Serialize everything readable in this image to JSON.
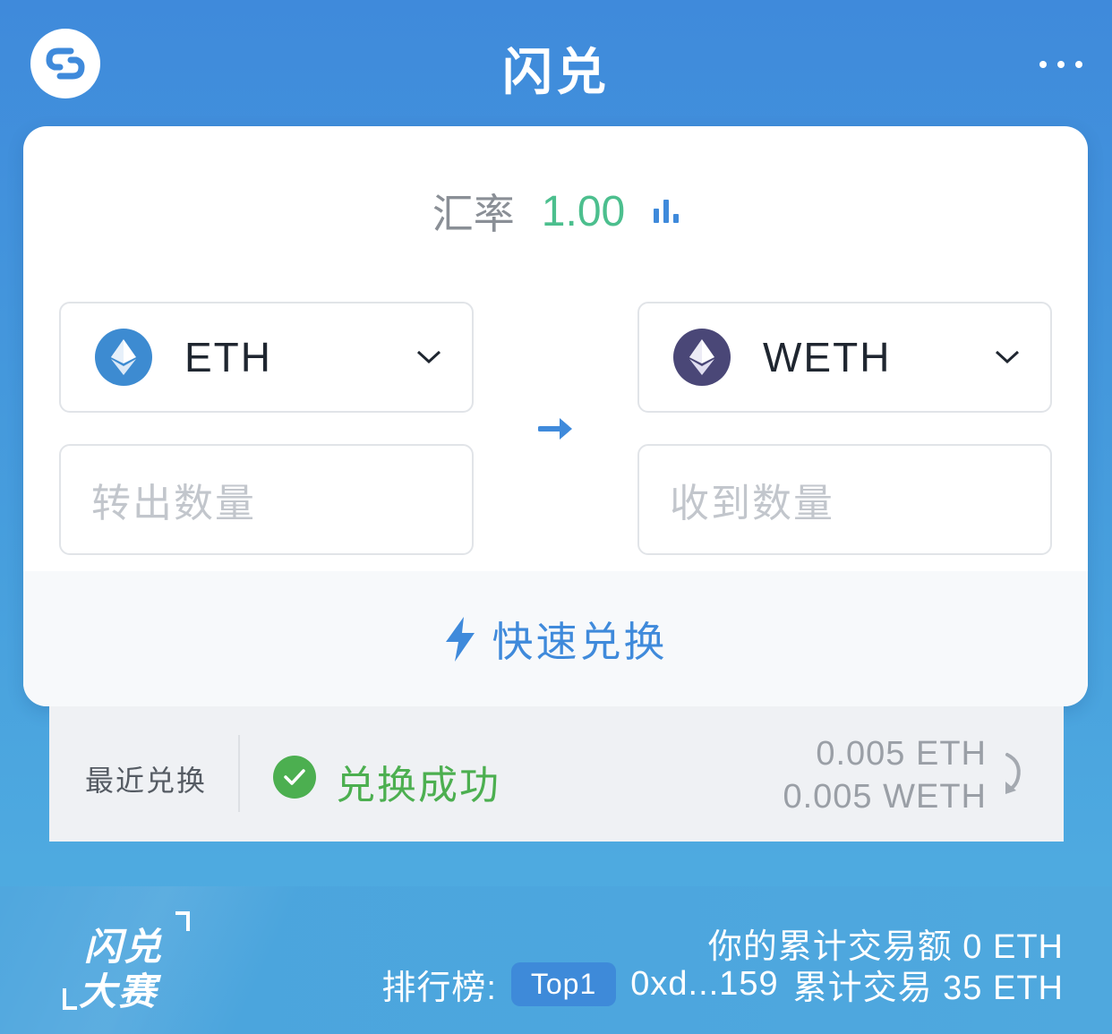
{
  "header": {
    "logo_icon": "swap-link-icon",
    "title": "闪兑",
    "more_icon": "more-dots-icon"
  },
  "rate": {
    "label": "汇率",
    "value": "1.00",
    "chart_icon": "bar-chart-icon"
  },
  "from": {
    "token": "ETH",
    "token_color": "#3d8bd1",
    "amount_placeholder": "转出数量"
  },
  "to": {
    "token": "WETH",
    "token_color": "#4a4777",
    "amount_placeholder": "收到数量"
  },
  "quick_swap": {
    "label": "快速兑换",
    "icon": "lightning-icon"
  },
  "recent": {
    "label": "最近兑换",
    "status": "兑换成功",
    "status_color": "#4caf50",
    "amount_from": "0.005 ETH",
    "amount_to": "0.005 WETH",
    "refresh_icon": "refresh-icon"
  },
  "contest": {
    "logo_line1": "闪兑",
    "logo_line2": "大赛",
    "cumulative": "你的累计交易额 0 ETH",
    "rank_label": "排行榜:",
    "rank_badge": "Top1",
    "rank_address": "0xd...159",
    "rank_volume": "累计交易 35 ETH"
  },
  "colors": {
    "brand_blue": "#3f8adb",
    "rate_green": "#4cbf8e"
  }
}
